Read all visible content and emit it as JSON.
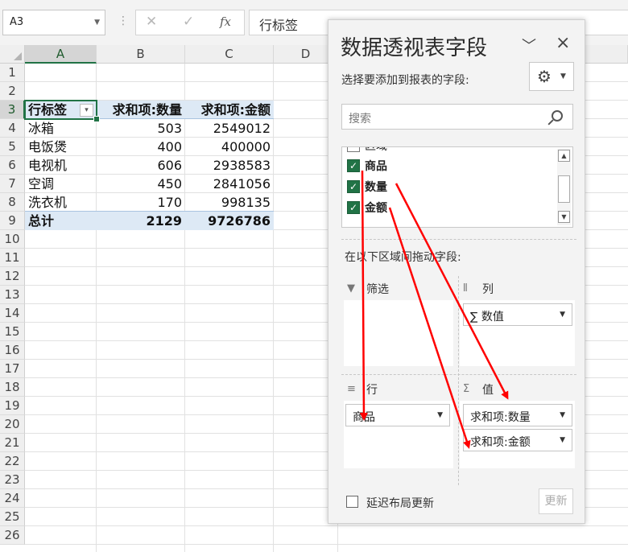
{
  "formula_bar": {
    "name_box": "A3",
    "cancel_icon": "✕",
    "enter_icon": "✓",
    "fx": "fx",
    "formula": "行标签"
  },
  "grid": {
    "columns": [
      "A",
      "B",
      "C",
      "D"
    ],
    "rows": [
      "1",
      "2",
      "3",
      "4",
      "5",
      "6",
      "7",
      "8",
      "9",
      "10",
      "11",
      "12",
      "13",
      "14",
      "15",
      "16",
      "17",
      "18",
      "19",
      "20",
      "21",
      "22",
      "23",
      "24",
      "25",
      "26"
    ],
    "selected_cell": "A3"
  },
  "pivot_table": {
    "header": {
      "row_label": "行标签",
      "sum_qty": "求和项:数量",
      "sum_amount": "求和项:金额",
      "filter_icon": "▾"
    },
    "rows": [
      {
        "name": "冰箱",
        "qty": "503",
        "amount": "2549012"
      },
      {
        "name": "电饭煲",
        "qty": "400",
        "amount": "400000"
      },
      {
        "name": "电视机",
        "qty": "606",
        "amount": "2938583"
      },
      {
        "name": "空调",
        "qty": "450",
        "amount": "2841056"
      },
      {
        "name": "洗衣机",
        "qty": "170",
        "amount": "998135"
      }
    ],
    "total": {
      "label": "总计",
      "qty": "2129",
      "amount": "9726786"
    }
  },
  "panel": {
    "title": "数据透视表字段",
    "choose_label": "选择要添加到报表的字段:",
    "search_placeholder": "搜索",
    "fields": [
      {
        "label": "区域",
        "checked": false
      },
      {
        "label": "商品",
        "checked": true
      },
      {
        "label": "数量",
        "checked": true
      },
      {
        "label": "金额",
        "checked": true
      }
    ],
    "drag_label": "在以下区域间拖动字段:",
    "areas": {
      "filter": {
        "label": "筛选"
      },
      "columns": {
        "label": "列",
        "items": [
          "数值"
        ]
      },
      "rows": {
        "label": "行",
        "items": [
          "商品"
        ]
      },
      "values": {
        "label": "值",
        "items": [
          "求和项:数量",
          "求和项:金额"
        ]
      }
    },
    "defer_label": "延迟布局更新",
    "update_button": "更新"
  },
  "colors": {
    "accent": "#217346",
    "arrow": "#ff0000",
    "band": "#dde9f5"
  },
  "icons": {
    "gear": "gear-icon",
    "search": "search-icon",
    "filter": "filter-icon",
    "columns": "columns-icon",
    "rows": "rows-icon",
    "sigma": "sigma-icon"
  }
}
